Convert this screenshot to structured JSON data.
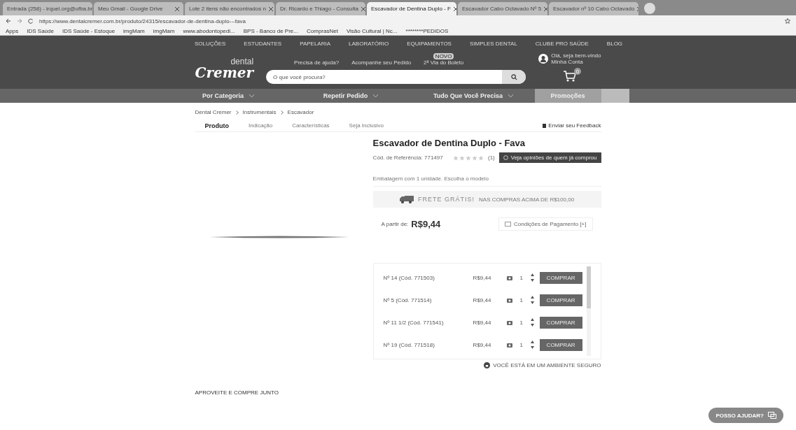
{
  "browser": {
    "tabs": [
      {
        "label": "Entrada (258) - irquel.org@ufba.br",
        "selected": false
      },
      {
        "label": "Meu Gmail - Google Drive",
        "selected": false
      },
      {
        "label": "Lote 2 itens não encontrados n",
        "selected": false
      },
      {
        "label": "Dr. Ricardo e Thiago - Consulta",
        "selected": false
      },
      {
        "label": "Escavador de Dentina Duplo - F",
        "selected": true
      },
      {
        "label": "Escavador Cabo Octavado Nº 5",
        "selected": false
      },
      {
        "label": "Escavador nº 10 Cabo Octavado",
        "selected": false
      }
    ],
    "url": "https://www.dentalcremer.com.br/produto/24315/escavador-de-dentina-duplo---fava",
    "bookmarks": [
      "Apps",
      "IDS Saúde",
      "IDS Saúde - Estoque",
      "imgMam",
      "imgMam",
      "www.abodontopedi...",
      "BPS - Banco de Pre...",
      "ComprasNet",
      "Visão Cultural | Nc...",
      "********PEDIDOS"
    ]
  },
  "top_nav": [
    "SOLUÇÕES",
    "ESTUDANTES",
    "PAPELARIA",
    "LABORATÓRIO",
    "EQUIPAMENTOS",
    "SIMPLES DENTAL",
    "CLUBE PRO SAÚDE",
    "BLOG"
  ],
  "header": {
    "logo_top": "dental",
    "logo_main": "Cremer",
    "help": "Precisa de ajuda?",
    "track": "Acompanhe seu Pedido",
    "boleto_badge": "NOVO",
    "boleto": "2ª Via do Boleto",
    "greeting": "Olá, seja bem-vindo",
    "account": "Minha Conta",
    "search_placeholder": "O que você procura?",
    "cart_count": "0"
  },
  "category_nav": [
    {
      "label": "Por Categoria",
      "dropdown": true,
      "highlight": false
    },
    {
      "label": "Repetir Pedido",
      "dropdown": true,
      "highlight": false
    },
    {
      "label": "Tudo Que Você Precisa",
      "dropdown": true,
      "highlight": false
    },
    {
      "label": "Promoções",
      "dropdown": false,
      "highlight": true
    }
  ],
  "breadcrumb": [
    "Dental Cremer",
    "Instrumentais",
    "Escavador"
  ],
  "product_tabs": [
    {
      "label": "Produto",
      "selected": true
    },
    {
      "label": "Indicação",
      "selected": false
    },
    {
      "label": "Características",
      "selected": false
    },
    {
      "label": "Seja Inclusivo",
      "selected": false
    }
  ],
  "feedback": "Enviar seu Feedback",
  "product": {
    "title": "Escavador de Dentina Duplo - Fava",
    "reference": "Cód. de Referência: 771497",
    "stars": 0,
    "review_count": "(1)",
    "reviews_button": "Veja opiniões de quem já comprou",
    "packaging": "Embalagem com 1 unidade. Escolha o modelo",
    "shipping_title": "FRETE GRÁTIS!",
    "shipping_text": "NAS COMPRAS ACIMA DE R$100,00",
    "price_label": "A partir de:",
    "price": "R$9,44",
    "payment": "Condições de Pagamento [+]",
    "variants": [
      {
        "name": "Nº 14 (Cód. 771503)",
        "price": "R$9,44",
        "qty": "1",
        "button": "COMPRAR"
      },
      {
        "name": "Nº 5 (Cód. 771514)",
        "price": "R$9,44",
        "qty": "1",
        "button": "COMPRAR"
      },
      {
        "name": "Nº 11 1/2 (Cód. 771541)",
        "price": "R$9,44",
        "qty": "1",
        "button": "COMPRAR"
      },
      {
        "name": "Nº 19 (Cód. 771518)",
        "price": "R$9,44",
        "qty": "1",
        "button": "COMPRAR"
      }
    ],
    "secure": "VOCÊ ESTÁ EM UM AMBIENTE SEGURO"
  },
  "related_title": "APROVEITE E COMPRE JUNTO",
  "chat_button": "POSSO AJUDAR?"
}
